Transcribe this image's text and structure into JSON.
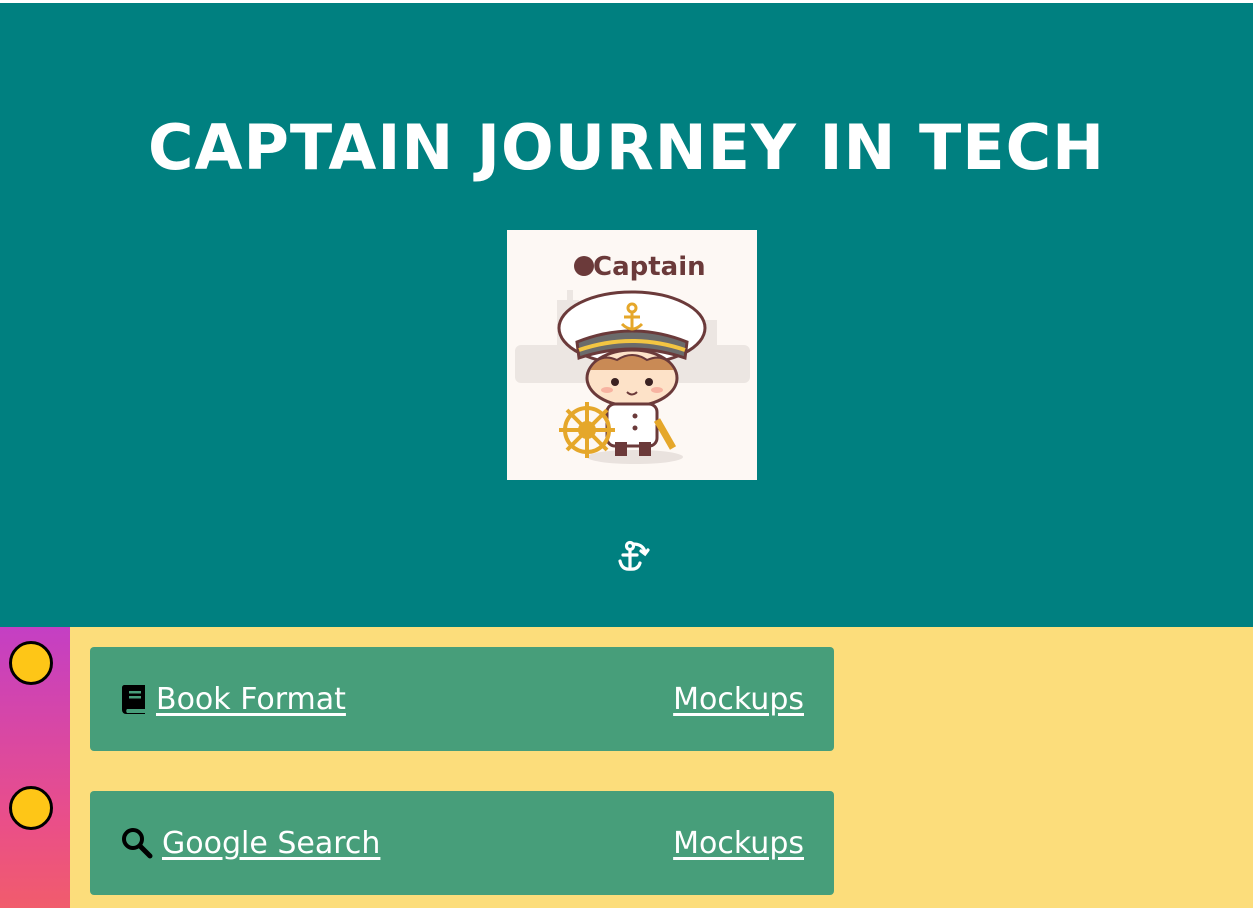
{
  "header": {
    "title": "CAPTAIN JOURNEY IN TECH",
    "logo": {
      "wordmark": "Captain",
      "icon": "captain-character-logo"
    },
    "scroll_icon": "anchor-icon"
  },
  "colors": {
    "hero_bg": "#008080",
    "section_bg": "#fcdd7b",
    "card_bg": "#479e7a",
    "timeline_top": "#c43fc4",
    "timeline_bottom": "#f15c6c",
    "dot": "#fec617"
  },
  "projects": [
    {
      "icon": "book-icon",
      "title": "Book Format",
      "link": "Mockups"
    },
    {
      "icon": "search-icon",
      "title": "Google Search",
      "link": "Mockups"
    }
  ]
}
